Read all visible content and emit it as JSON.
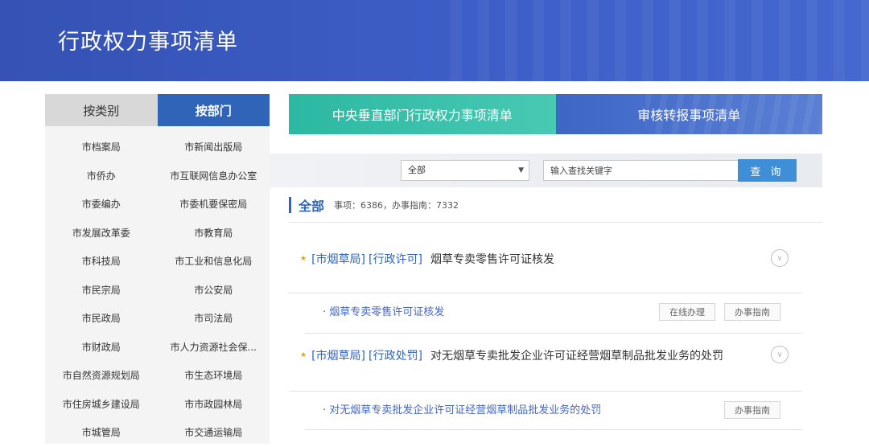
{
  "header": {
    "title": "行政权力事项清单"
  },
  "sidebar": {
    "tabs": [
      {
        "label": "按类别",
        "active": false
      },
      {
        "label": "按部门",
        "active": true
      }
    ],
    "departments": [
      "市档案局",
      "市新闻出版局",
      "市侨办",
      "市互联网信息办公室",
      "市委编办",
      "市委机要保密局",
      "市发展改革委",
      "市教育局",
      "市科技局",
      "市工业和信息化局",
      "市民宗局",
      "市公安局",
      "市民政局",
      "市司法局",
      "市财政局",
      "市人力资源社会保...",
      "市自然资源规划局",
      "市生态环境局",
      "市住房城乡建设局",
      "市市政园林局",
      "市城管局",
      "市交通运输局"
    ]
  },
  "main_tabs": [
    {
      "label": "中央垂直部门行政权力事项清单"
    },
    {
      "label": "审核转报事项清单"
    }
  ],
  "search": {
    "select_value": "全部",
    "placeholder": "输入查找关键字",
    "button_label": "查 询"
  },
  "summary": {
    "heading": "全部",
    "stats": "事项：6386，办事指南：7332"
  },
  "items": [
    {
      "dept_tag": "[市烟草局]",
      "type_tag": "[行政许可]",
      "title": "烟草专卖零售许可证核发",
      "sub_title": "· 烟草专卖零售许可证核发",
      "online_label": "在线办理",
      "guide_label": "办事指南"
    },
    {
      "dept_tag": "[市烟草局]",
      "type_tag": "[行政处罚]",
      "title": "对无烟草专卖批发企业许可证经营烟草制品批发业务的处罚",
      "sub_title": "· 对无烟草专卖批发企业许可证经营烟草制品批发业务的处罚",
      "guide_label": "办事指南"
    }
  ],
  "colors": {
    "header_bg": "#3c5cc4",
    "active_tab": "#2f64b8",
    "teal_tab": "#2cb8a2",
    "search_button": "#3e8ed8",
    "link": "#4466c8"
  }
}
